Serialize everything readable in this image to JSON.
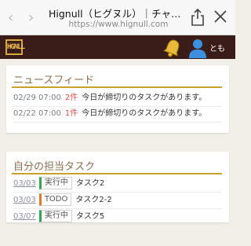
{
  "browser": {
    "title": "Hignull（ヒグヌル）｜チャットで業務管理",
    "url": "https://www.hignull.com",
    "back_glyph": "‹",
    "forward_glyph": "›"
  },
  "header": {
    "logo_text": "HGNLL",
    "user_name": "とも",
    "icons": [
      "bell-icon",
      "user-avatar-icon"
    ]
  },
  "news": {
    "title": "ニュースフィード",
    "items": [
      {
        "date": "02/29 07:00",
        "count": "2件",
        "message": "今日が締切りのタスクがあります。"
      },
      {
        "date": "02/22 07:00",
        "count": "1件",
        "message": "今日が締切りのタスクがあります。"
      }
    ]
  },
  "tasks": {
    "title": "自分の担当タスク",
    "items": [
      {
        "date": "03/03",
        "status": "実行中",
        "name": "タスク2"
      },
      {
        "date": "03/03",
        "status": "TODO",
        "name": "タスク2-2"
      },
      {
        "date": "03/07",
        "status": "実行中",
        "name": "タスク5"
      }
    ]
  },
  "colors": {
    "header_bg": "#3a1d18",
    "accent_gold": "#c9a22a",
    "status_running": "#2fa84f",
    "status_todo": "#e8772e",
    "alert_red": "#d9534f"
  }
}
